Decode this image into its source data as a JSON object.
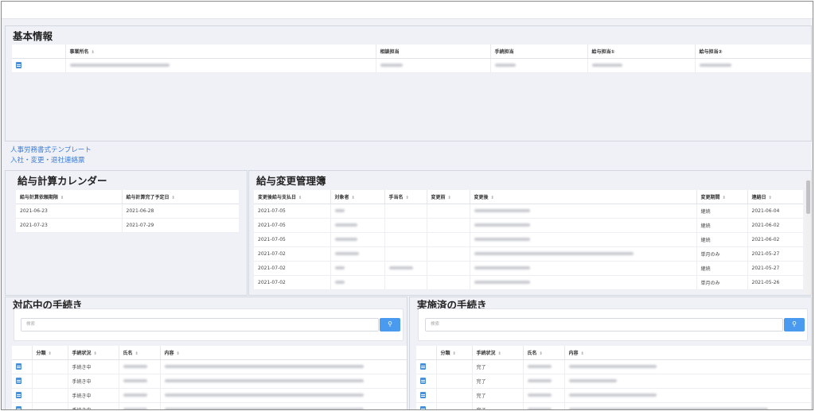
{
  "basic": {
    "title": "基本情報",
    "headers": [
      "",
      "事業所名",
      "相談担当",
      "手続担当",
      "給与担当①",
      "給与担当②"
    ],
    "sort_icon": "⇕"
  },
  "links": [
    "人事労務書式テンプレート",
    "入社・変更・退社連絡票"
  ],
  "calendar": {
    "title": "給与計算カレンダー",
    "headers": [
      "給与計算依頼期限",
      "給与計算完了予定日"
    ],
    "rows": [
      [
        "2021-06-23",
        "2021-06-28"
      ],
      [
        "2021-07-23",
        "2021-07-29"
      ]
    ]
  },
  "changes": {
    "title": "給与変更管理簿",
    "headers": [
      "変更後給与支払日",
      "対象者",
      "手当名",
      "変更前",
      "変更後",
      "変更期間",
      "連絡日"
    ],
    "rows": [
      [
        "2021-07-05",
        "継続",
        "2021-06-04"
      ],
      [
        "2021-07-05",
        "継続",
        "2021-06-02"
      ],
      [
        "2021-07-05",
        "継続",
        "2021-06-02"
      ],
      [
        "2021-07-02",
        "単月のみ",
        "2021-05-27"
      ],
      [
        "2021-07-02",
        "継続",
        "2021-05-27"
      ],
      [
        "2021-07-02",
        "単月のみ",
        "2021-05-26"
      ]
    ]
  },
  "inprogress": {
    "title": "対応中の手続き",
    "search_placeholder": "検索",
    "headers": [
      "",
      "分類",
      "手続状況",
      "氏名",
      "内容"
    ],
    "status": [
      "手続き中",
      "手続き中",
      "手続き中",
      "手続き中"
    ]
  },
  "done": {
    "title": "実施済の手続き",
    "search_placeholder": "検索",
    "headers": [
      "",
      "分類",
      "手続状況",
      "氏名",
      "内容"
    ],
    "status": [
      "完了",
      "完了",
      "完了",
      "完了"
    ]
  },
  "icons": {
    "search": "search-icon",
    "doc": "document-icon",
    "sort": "sort-icon"
  }
}
